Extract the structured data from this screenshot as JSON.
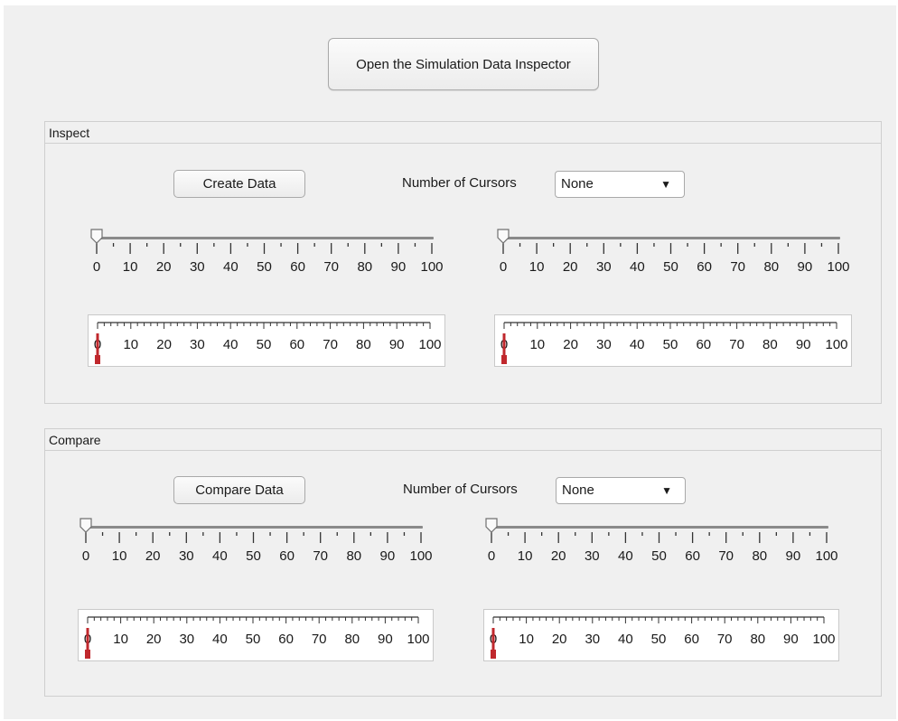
{
  "header": {
    "open_sdi_label": "Open the Simulation Data Inspector"
  },
  "scale": {
    "ticks": [
      "0",
      "10",
      "20",
      "30",
      "40",
      "50",
      "60",
      "70",
      "80",
      "90",
      "100"
    ]
  },
  "inspect": {
    "title": "Inspect",
    "action_label": "Create Data",
    "cursors_label": "Number of Cursors",
    "cursors_value": "None",
    "slider_left_value": 0,
    "slider_right_value": 0,
    "gauge_left_value": 0,
    "gauge_right_value": 0
  },
  "compare": {
    "title": "Compare",
    "action_label": "Compare Data",
    "cursors_label": "Number of Cursors",
    "cursors_value": "None",
    "slider_left_value": 0,
    "slider_right_value": 0,
    "gauge_left_value": 0,
    "gauge_right_value": 0
  },
  "colors": {
    "needle": "#c0282d",
    "track": "#8a8a8a"
  },
  "icons": {
    "dropdown": "chevron-down-icon",
    "slider_thumb": "slider-thumb-icon",
    "needle": "gauge-needle-icon"
  }
}
